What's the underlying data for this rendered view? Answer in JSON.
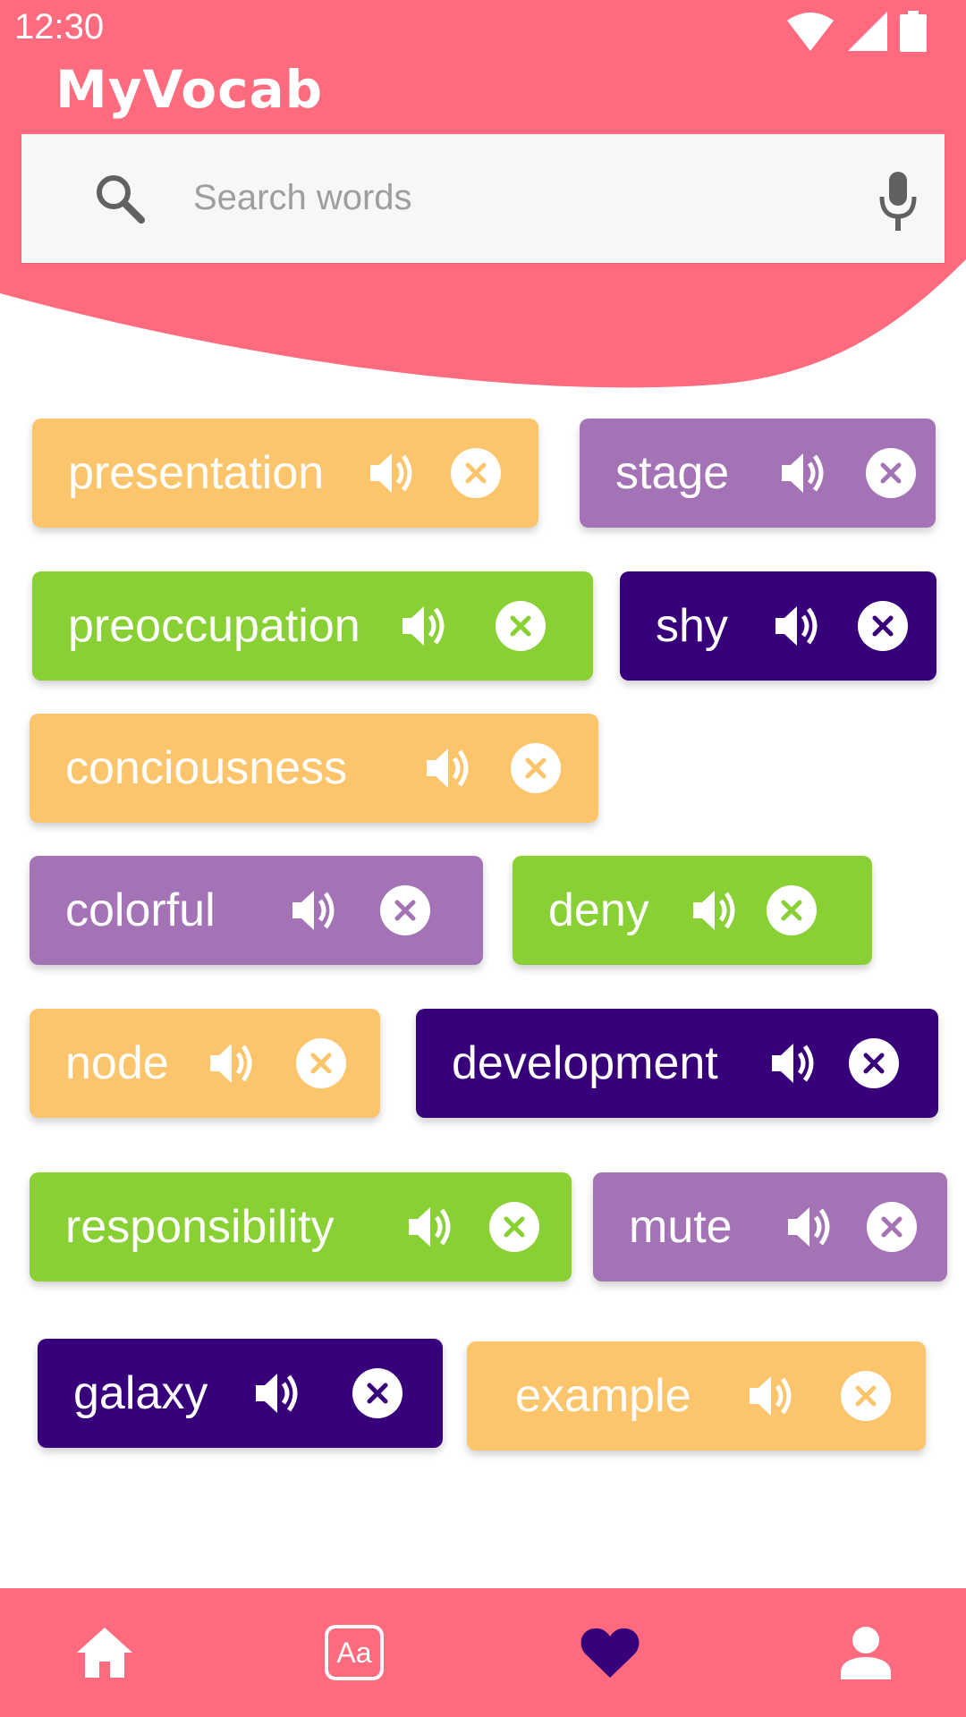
{
  "status_bar": {
    "time": "12:30"
  },
  "app": {
    "title": "MyVocab"
  },
  "search": {
    "placeholder": "Search words",
    "value": ""
  },
  "colors": {
    "header": "#fe6b7e",
    "orange": "#fcc56c",
    "purple": "#a373b5",
    "green": "#88d033",
    "indigo": "#37007a"
  },
  "words": [
    {
      "label": "presentation",
      "color": "orange"
    },
    {
      "label": "stage",
      "color": "purple"
    },
    {
      "label": "preoccupation",
      "color": "green"
    },
    {
      "label": "shy",
      "color": "indigo"
    },
    {
      "label": "conciousness",
      "color": "orange"
    },
    {
      "label": "colorful",
      "color": "purple"
    },
    {
      "label": "deny",
      "color": "green"
    },
    {
      "label": "node",
      "color": "orange"
    },
    {
      "label": "development",
      "color": "indigo"
    },
    {
      "label": "responsibility",
      "color": "green"
    },
    {
      "label": "mute",
      "color": "purple"
    },
    {
      "label": "galaxy",
      "color": "indigo"
    },
    {
      "label": "example",
      "color": "orange"
    }
  ],
  "bottom_nav": {
    "items": [
      {
        "icon": "home-icon",
        "label": ""
      },
      {
        "icon": "dictionary-icon",
        "label": "Aa"
      },
      {
        "icon": "heart-icon",
        "label": "",
        "active": true
      },
      {
        "icon": "profile-icon",
        "label": ""
      }
    ]
  }
}
